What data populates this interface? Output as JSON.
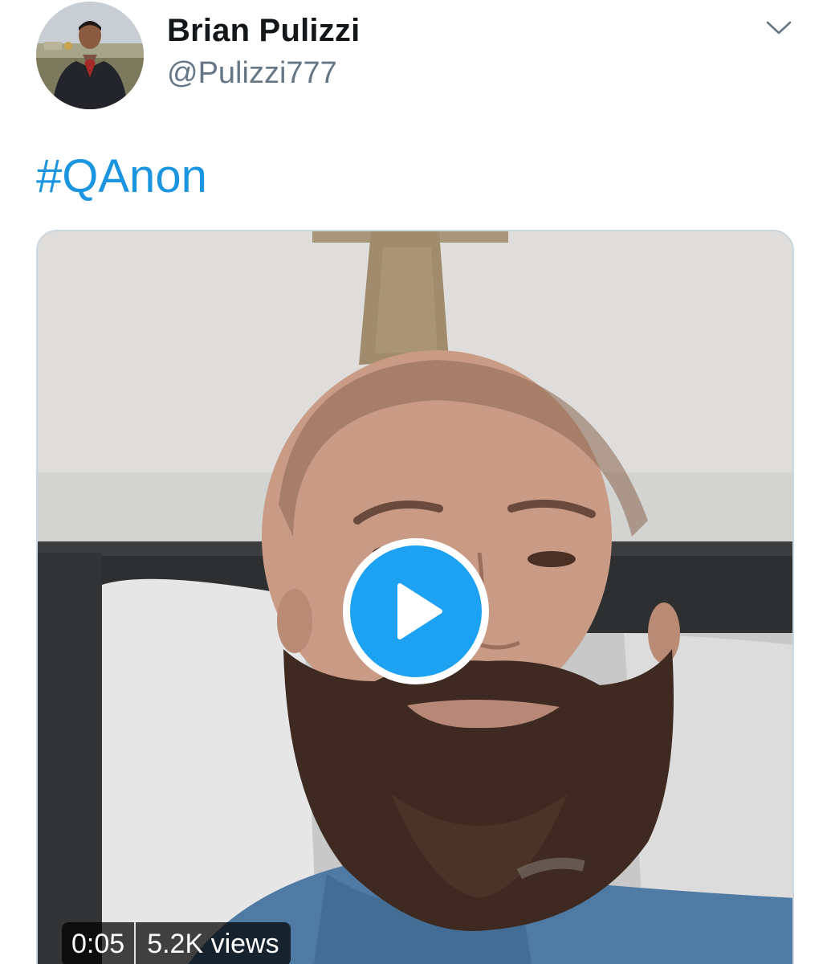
{
  "tweet": {
    "author": {
      "display_name": "Brian Pulizzi",
      "handle": "@Pulizzi777"
    },
    "text": "#QAnon",
    "menu_icon": "chevron-down-icon"
  },
  "video": {
    "duration": "0:05",
    "views": "5.2K views",
    "play_icon": "play-icon"
  },
  "colors": {
    "accent": "#1da1f2",
    "hashtag": "#1b95e0",
    "name": "#14171a",
    "secondary": "#657786"
  }
}
